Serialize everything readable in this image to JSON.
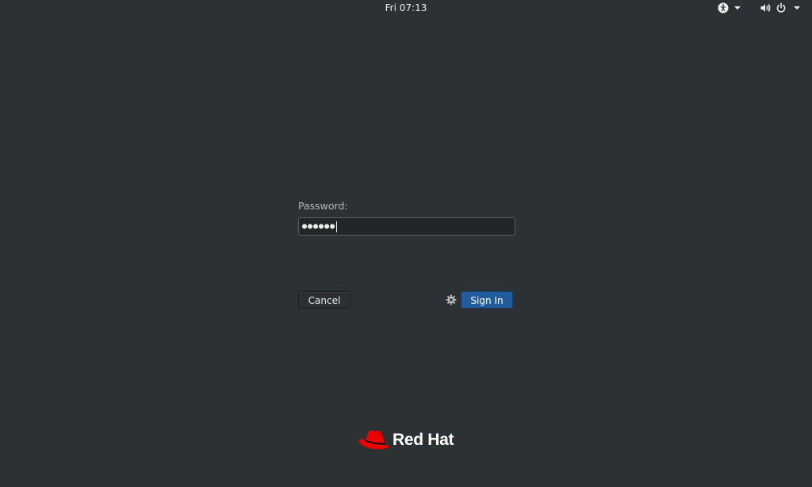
{
  "top_bar": {
    "clock": "Fri 07:13",
    "icons": {
      "accessibility": "accessibility-icon",
      "volume": "volume-icon",
      "power": "power-icon"
    }
  },
  "login": {
    "prompt_label": "Password:",
    "password_masked": "●●●●●●",
    "password_length": 6,
    "cancel_label": "Cancel",
    "sign_in_label": "Sign In",
    "session_icon": "gear-icon"
  },
  "branding": {
    "logo_text": "Red Hat",
    "logo_icon": "red-hat-fedora-icon"
  },
  "colors": {
    "background": "#2e3134",
    "accent": "#215d9c",
    "brand_red": "#ee0000"
  }
}
